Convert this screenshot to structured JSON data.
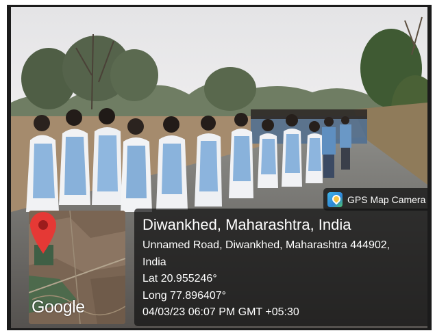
{
  "gps_badge": {
    "app_name": "GPS Map Camera"
  },
  "location": {
    "title": "Diwankhed, Maharashtra, India",
    "address_line1": "Unnamed Road, Diwankhed, Maharashtra 444902,",
    "address_line2": "India",
    "latitude": "Lat 20.955246°",
    "longitude": "Long 77.896407°",
    "datetime": "04/03/23 06:07 PM GMT +05:30"
  },
  "map": {
    "logo_text": "Google",
    "pin_color": "#e53935"
  },
  "colors": {
    "uniform_top": "#8ab4dc",
    "uniform_shawl": "#f2f2f4",
    "overlay_bg": "#141414"
  },
  "icons": [
    "gps-map-camera-icon",
    "map-pin-icon"
  ]
}
